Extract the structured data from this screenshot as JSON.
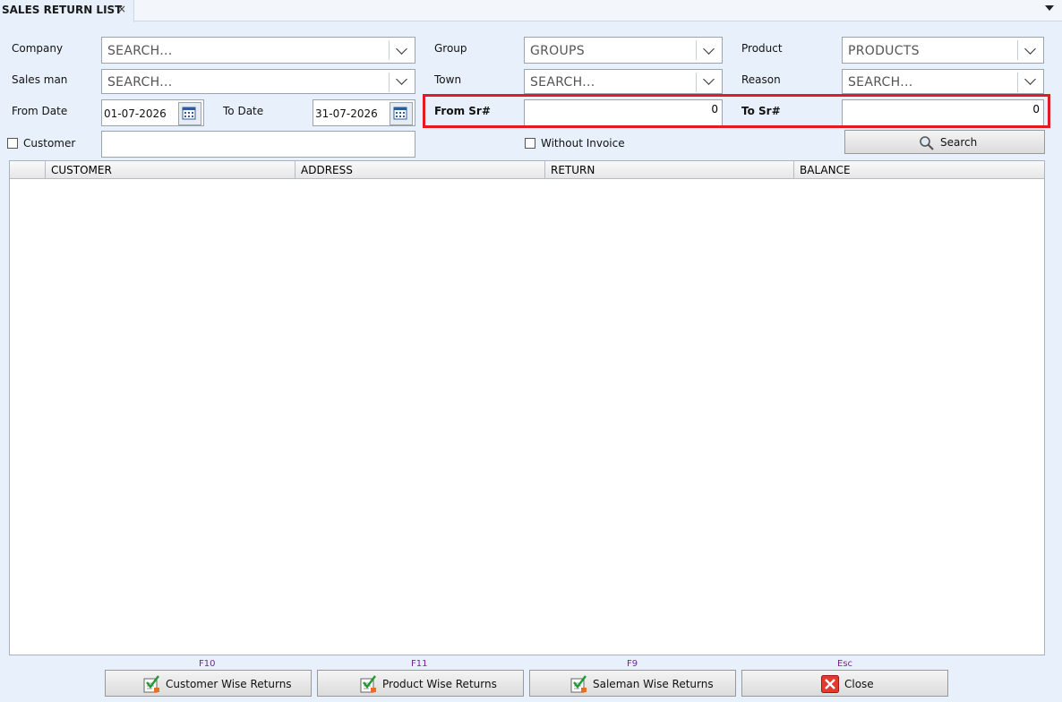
{
  "tab": {
    "title": "SALES RETURN LIST",
    "close": "×"
  },
  "filters": {
    "company": {
      "label": "Company",
      "value": "SEARCH..."
    },
    "salesman": {
      "label": "Sales man",
      "value": "SEARCH..."
    },
    "from_date": {
      "label": "From Date",
      "value": "01-07-2026"
    },
    "to_date": {
      "label": "To Date",
      "value": "31-07-2026"
    },
    "customer": {
      "label": "Customer",
      "value": ""
    },
    "group": {
      "label": "Group",
      "value": "GROUPS"
    },
    "town": {
      "label": "Town",
      "value": "SEARCH..."
    },
    "from_sr": {
      "label": "From Sr#",
      "value": "0"
    },
    "without_invoice": {
      "label": "Without Invoice"
    },
    "product": {
      "label": "Product",
      "value": "PRODUCTS"
    },
    "reason": {
      "label": "Reason",
      "value": "SEARCH..."
    },
    "to_sr": {
      "label": "To Sr#",
      "value": "0"
    }
  },
  "search_button": {
    "label": "Search"
  },
  "grid": {
    "columns": [
      "CUSTOMER",
      "ADDRESS",
      "RETURN",
      "BALANCE"
    ],
    "rows": []
  },
  "footer": {
    "customer_wise": {
      "key": "F10",
      "label": "Customer Wise Returns"
    },
    "product_wise": {
      "key": "F11",
      "label": "Product Wise Returns"
    },
    "saleman_wise": {
      "key": "F9",
      "label": "Saleman Wise Returns"
    },
    "close": {
      "key": "Esc",
      "label": "Close"
    }
  },
  "colors": {
    "highlight": "#e01b24",
    "background": "#e8f1fb",
    "fkey": "#7a1fa2"
  }
}
